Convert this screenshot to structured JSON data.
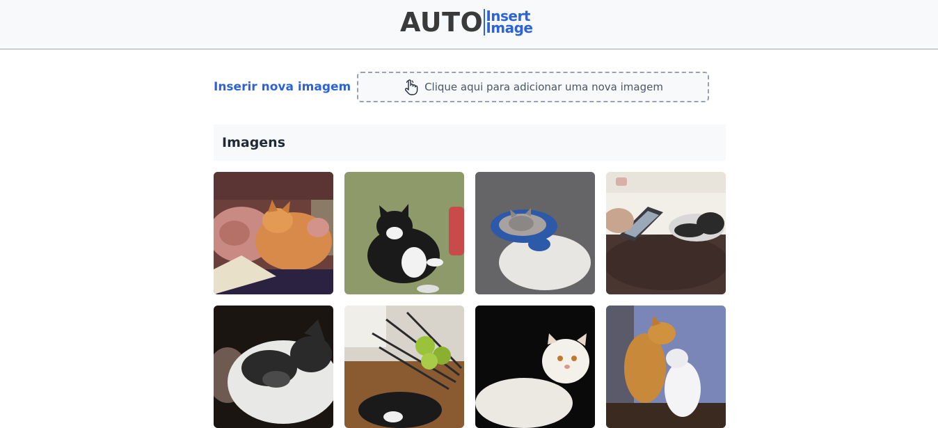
{
  "header": {
    "logo_main": "AUTO",
    "logo_sub_top": "Insert",
    "logo_sub_bottom": "Image"
  },
  "upload": {
    "label": "Inserir nova imagem",
    "dropzone_text": "Clique aqui para adicionar uma nova imagem",
    "icon": "pointer-hand-icon"
  },
  "gallery": {
    "title": "Imagens",
    "images": [
      {
        "subject": "man hugging orange cat"
      },
      {
        "subject": "black and white cat lying on green blanket"
      },
      {
        "subject": "kitten sleeping in slipper"
      },
      {
        "subject": "cat lying beside tablet"
      },
      {
        "subject": "black and white cat sleeping close-up"
      },
      {
        "subject": "cat under bowl with apples"
      },
      {
        "subject": "white persian cat"
      },
      {
        "subject": "orange cat and white cat"
      }
    ]
  },
  "colors": {
    "accent": "#2c63d9",
    "logo_dark": "#3a3a3a",
    "header_bg": "#f8f9fa"
  }
}
